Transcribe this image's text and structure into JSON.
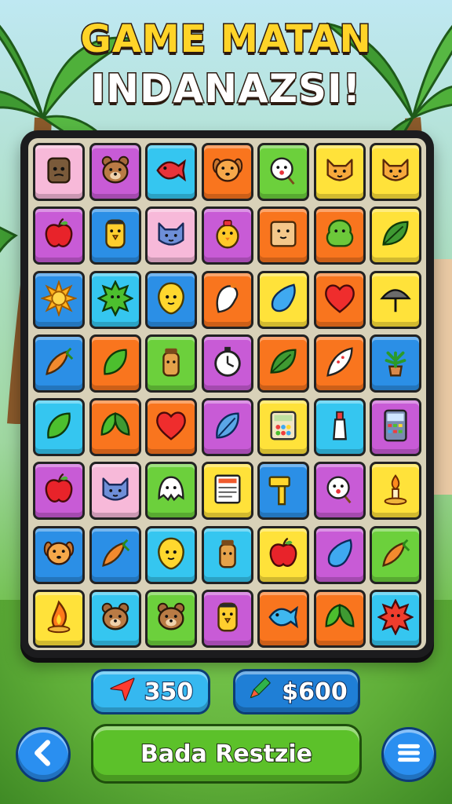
{
  "title": {
    "line1": "GAME MATAN",
    "line2": "INDANAZSI!"
  },
  "colors": {
    "pink": "#f7b9d9",
    "magenta": "#c85bd6",
    "cyan": "#35c6f0",
    "orange": "#f9751e",
    "green": "#6cd03c",
    "yellow": "#ffe23a",
    "blue": "#2b8fe6",
    "red": "#ef3d3d",
    "title_yellow": "#ffd428",
    "button_green": "#5cc12a",
    "button_blue": "#2a8ff0"
  },
  "board": {
    "rows": [
      [
        {
          "bg": "pink",
          "icon": "stone-face-icon"
        },
        {
          "bg": "magenta",
          "icon": "bear-face-icon"
        },
        {
          "bg": "cyan",
          "icon": "red-fish-icon"
        },
        {
          "bg": "orange",
          "icon": "dog-face-icon"
        },
        {
          "bg": "green",
          "icon": "flower-lollipop-icon"
        },
        {
          "bg": "yellow",
          "icon": "cat-face-icon"
        },
        {
          "bg": "yellow",
          "icon": "cat-face-icon"
        }
      ],
      [
        {
          "bg": "magenta",
          "icon": "apple-icon"
        },
        {
          "bg": "blue",
          "icon": "bird-face-icon"
        },
        {
          "bg": "pink",
          "icon": "blue-cat-icon"
        },
        {
          "bg": "magenta",
          "icon": "chick-icon"
        },
        {
          "bg": "orange",
          "icon": "note-face-icon"
        },
        {
          "bg": "orange",
          "icon": "green-blob-icon"
        },
        {
          "bg": "yellow",
          "icon": "leaf-icon"
        }
      ],
      [
        {
          "bg": "blue",
          "icon": "sun-icon"
        },
        {
          "bg": "cyan",
          "icon": "green-spiky-icon"
        },
        {
          "bg": "blue",
          "icon": "yellow-blob-icon"
        },
        {
          "bg": "orange",
          "icon": "ghost-icon"
        },
        {
          "bg": "yellow",
          "icon": "blue-drop-icon"
        },
        {
          "bg": "orange",
          "icon": "heart-icon"
        },
        {
          "bg": "yellow",
          "icon": "umbrella-icon"
        }
      ],
      [
        {
          "bg": "blue",
          "icon": "carrot-leaf-icon"
        },
        {
          "bg": "orange",
          "icon": "green-leaf-icon"
        },
        {
          "bg": "green",
          "icon": "jar-icon"
        },
        {
          "bg": "magenta",
          "icon": "clock-icon"
        },
        {
          "bg": "orange",
          "icon": "leaf-icon"
        },
        {
          "bg": "orange",
          "icon": "feather-icon"
        },
        {
          "bg": "blue",
          "icon": "potted-plant-icon"
        }
      ],
      [
        {
          "bg": "cyan",
          "icon": "green-leaf-icon"
        },
        {
          "bg": "orange",
          "icon": "leaves-icon"
        },
        {
          "bg": "orange",
          "icon": "heart-icon"
        },
        {
          "bg": "magenta",
          "icon": "blue-leaf-icon"
        },
        {
          "bg": "yellow",
          "icon": "calculator-icon"
        },
        {
          "bg": "cyan",
          "icon": "bottle-icon"
        },
        {
          "bg": "magenta",
          "icon": "phone-icon"
        }
      ],
      [
        {
          "bg": "magenta",
          "icon": "apple-icon"
        },
        {
          "bg": "pink",
          "icon": "blue-cat-icon"
        },
        {
          "bg": "green",
          "icon": "white-ghost-icon"
        },
        {
          "bg": "yellow",
          "icon": "newspaper-icon"
        },
        {
          "bg": "blue",
          "icon": "hammer-icon"
        },
        {
          "bg": "magenta",
          "icon": "flower-lollipop-icon"
        },
        {
          "bg": "yellow",
          "icon": "candle-icon"
        }
      ],
      [
        {
          "bg": "blue",
          "icon": "dog-face-icon"
        },
        {
          "bg": "blue",
          "icon": "carrot-leaf-icon"
        },
        {
          "bg": "cyan",
          "icon": "yellow-blob-icon"
        },
        {
          "bg": "cyan",
          "icon": "jar-icon"
        },
        {
          "bg": "yellow",
          "icon": "apple-icon"
        },
        {
          "bg": "magenta",
          "icon": "blue-drop-icon"
        },
        {
          "bg": "green",
          "icon": "carrot-leaf-icon"
        }
      ],
      [
        {
          "bg": "yellow",
          "icon": "fire-icon"
        },
        {
          "bg": "cyan",
          "icon": "bear-face-icon"
        },
        {
          "bg": "green",
          "icon": "bear-face-icon"
        },
        {
          "bg": "magenta",
          "icon": "bird-face-icon"
        },
        {
          "bg": "orange",
          "icon": "blue-fish-icon"
        },
        {
          "bg": "orange",
          "icon": "leaves-icon"
        },
        {
          "bg": "cyan",
          "icon": "red-spiky-icon"
        }
      ]
    ]
  },
  "stats": {
    "left": {
      "value": "350",
      "icon": "red-arrow-icon"
    },
    "right": {
      "value": "$600",
      "icon": "pencil-icon"
    }
  },
  "buttons": {
    "main_label": "Bada Restzie",
    "back_icon": "chevron-left-icon",
    "menu_icon": "menu-icon"
  }
}
